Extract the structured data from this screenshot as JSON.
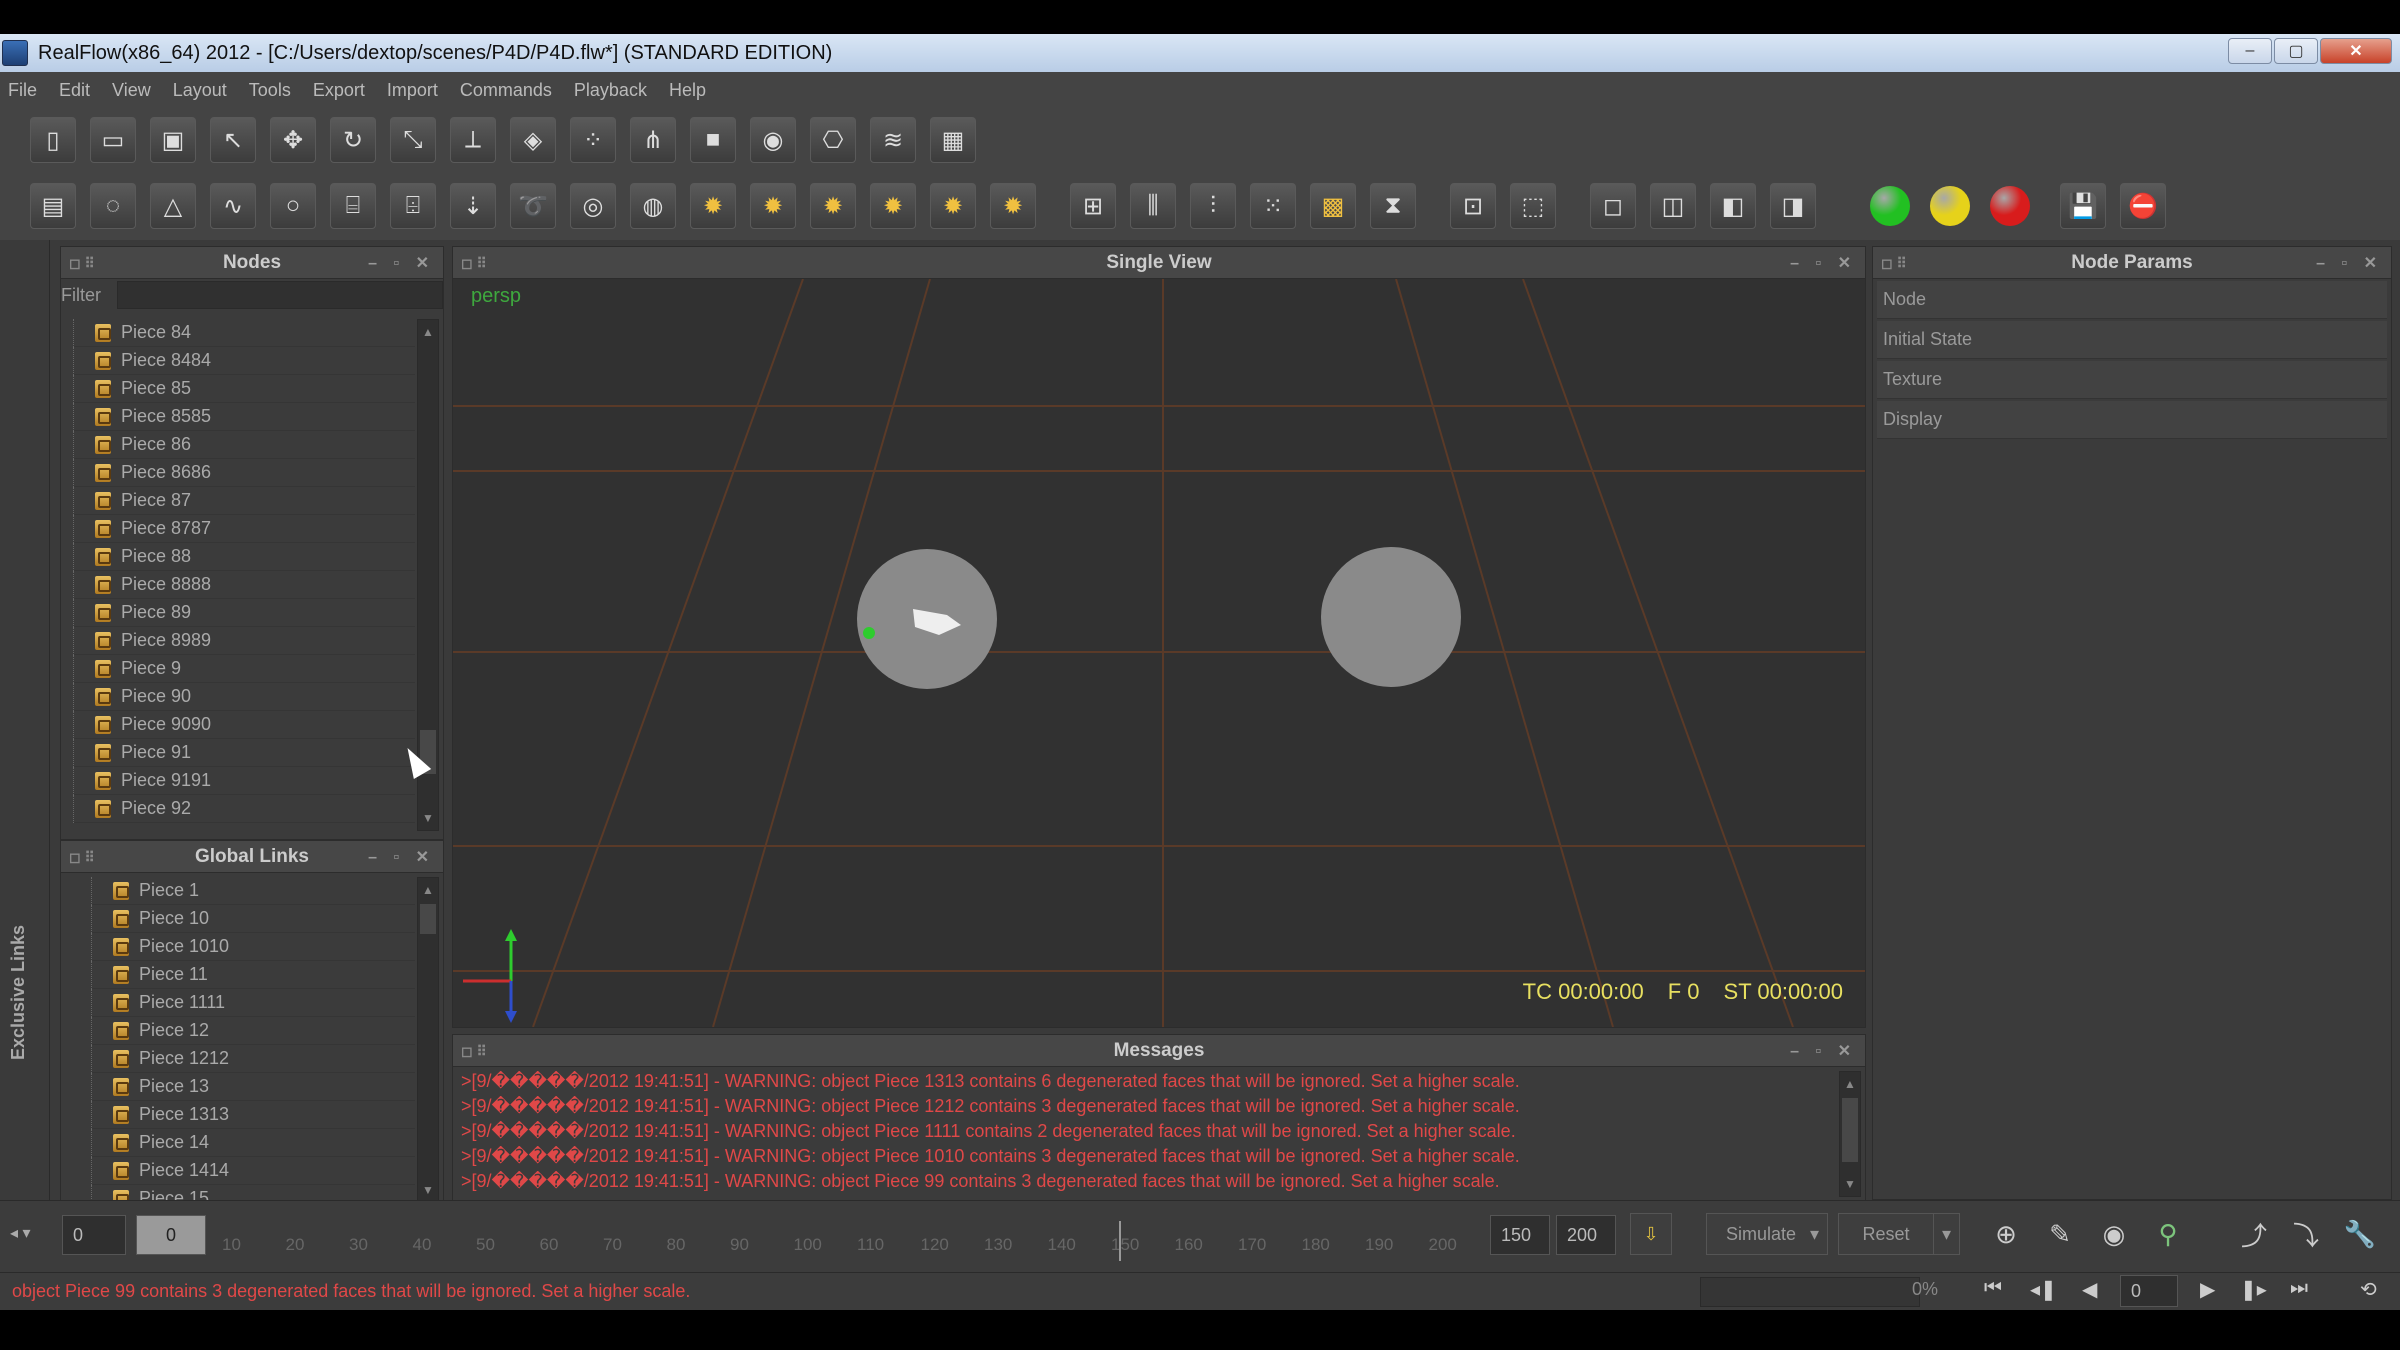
{
  "window": {
    "title": "RealFlow(x86_64) 2012 - [C:/Users/dextop/scenes/P4D/P4D.flw*] (STANDARD EDITION)",
    "btn_min": "–",
    "btn_max": "▢",
    "btn_close": "✕"
  },
  "menu": [
    "File",
    "Edit",
    "View",
    "Layout",
    "Tools",
    "Export",
    "Import",
    "Commands",
    "Playback",
    "Help"
  ],
  "toolbar1": [
    {
      "name": "new-scene-icon",
      "glyph": "▯"
    },
    {
      "name": "open-scene-icon",
      "glyph": "▭"
    },
    {
      "name": "save-scene-icon",
      "glyph": "▣"
    },
    {
      "name": "select-icon",
      "glyph": "↖"
    },
    {
      "name": "move-icon",
      "glyph": "✥"
    },
    {
      "name": "rotate-icon",
      "glyph": "↻"
    },
    {
      "name": "scale-icon",
      "glyph": "⤡"
    },
    {
      "name": "axis-icon",
      "glyph": "⟂"
    },
    {
      "name": "layers-icon",
      "glyph": "◈"
    },
    {
      "name": "particles-icon",
      "glyph": "⁘"
    },
    {
      "name": "constraint-icon",
      "glyph": "⋔"
    },
    {
      "name": "object-cube-icon",
      "glyph": "■"
    },
    {
      "name": "sphere-emitter-icon",
      "glyph": "◉"
    },
    {
      "name": "camera-icon",
      "glyph": "⎔"
    },
    {
      "name": "wave-icon",
      "glyph": "≋"
    },
    {
      "name": "mesh-icon",
      "glyph": "▦"
    }
  ],
  "toolbar2": [
    {
      "name": "emitter-square-icon",
      "glyph": "▤"
    },
    {
      "name": "emitter-circle-icon",
      "glyph": "◌"
    },
    {
      "name": "emitter-triangle-icon",
      "glyph": "△"
    },
    {
      "name": "emitter-spline-icon",
      "glyph": "∿"
    },
    {
      "name": "emitter-sphere-icon",
      "glyph": "○"
    },
    {
      "name": "emitter-cylinder-icon",
      "glyph": "⌸"
    },
    {
      "name": "emitter-fill-icon",
      "glyph": "⌹"
    },
    {
      "name": "daemon-gravity-icon",
      "glyph": "⇣"
    },
    {
      "name": "daemon-vortex-icon",
      "glyph": "➰"
    },
    {
      "name": "daemon-attractor-icon",
      "glyph": "◎"
    },
    {
      "name": "daemon-drag-icon",
      "glyph": "◍"
    },
    {
      "name": "light-1-icon",
      "glyph": "✹",
      "type": "sun"
    },
    {
      "name": "light-2-icon",
      "glyph": "✹",
      "type": "sun"
    },
    {
      "name": "light-3-icon",
      "glyph": "✹",
      "type": "sun"
    },
    {
      "name": "light-4-icon",
      "glyph": "✹",
      "type": "sun"
    },
    {
      "name": "light-5-icon",
      "glyph": "✹",
      "type": "sun"
    },
    {
      "name": "light-6-icon",
      "glyph": "✹",
      "type": "sun"
    },
    {
      "name": "mesher-icon",
      "glyph": "⊞",
      "gap": true
    },
    {
      "name": "wave-domain-icon",
      "glyph": "⫼"
    },
    {
      "name": "graph-icon",
      "glyph": "⫶"
    },
    {
      "name": "dots-icon",
      "glyph": "⁙"
    },
    {
      "name": "grid-mesh-icon",
      "glyph": "▩",
      "type": "cube"
    },
    {
      "name": "hourglass-icon",
      "glyph": "⧗"
    },
    {
      "name": "frame-icon",
      "glyph": "⊡",
      "gap": true
    },
    {
      "name": "dotted-frame-icon",
      "glyph": "⬚"
    },
    {
      "name": "view-front-icon",
      "glyph": "◻",
      "gap": true
    },
    {
      "name": "view-side-icon",
      "glyph": "◫"
    },
    {
      "name": "view-top-icon",
      "glyph": "◧"
    },
    {
      "name": "view-persp-icon",
      "glyph": "◨"
    }
  ],
  "status_lights": [
    {
      "name": "simulate-green-light",
      "color": "#22c022"
    },
    {
      "name": "simulate-yellow-light",
      "color": "#e6d21a"
    },
    {
      "name": "simulate-red-light",
      "color": "#d81c1c"
    }
  ],
  "save_icons": [
    {
      "name": "save-cache-icon",
      "glyph": "💾"
    },
    {
      "name": "reset-cache-icon",
      "glyph": "⛔"
    }
  ],
  "side_strip": {
    "label": "Exclusive Links"
  },
  "nodes_panel": {
    "title": "Nodes",
    "filter_label": "Filter",
    "filter_value": "",
    "items": [
      "Piece  84",
      "Piece  8484",
      "Piece  85",
      "Piece  8585",
      "Piece  86",
      "Piece  8686",
      "Piece  87",
      "Piece  8787",
      "Piece  88",
      "Piece  8888",
      "Piece  89",
      "Piece  8989",
      "Piece  9",
      "Piece  90",
      "Piece  9090",
      "Piece  91",
      "Piece  9191",
      "Piece  92"
    ]
  },
  "global_links_panel": {
    "title": "Global Links",
    "items": [
      "Piece  1",
      "Piece  10",
      "Piece  1010",
      "Piece  11",
      "Piece  1111",
      "Piece  12",
      "Piece  1212",
      "Piece  13",
      "Piece  1313",
      "Piece  14",
      "Piece  1414",
      "Piece  15"
    ]
  },
  "viewport": {
    "title": "Single View",
    "camera_label": "persp",
    "tc": "TC 00:00:00",
    "frame": "F 0",
    "st": "ST 00:00:00"
  },
  "messages_panel": {
    "title": "Messages",
    "lines": [
      ">[9/�����/2012 19:41:51] - WARNING: object Piece  1313 contains 6 degenerated faces that will be ignored. Set a higher scale.",
      ">[9/�����/2012 19:41:51] - WARNING: object Piece  1212 contains 3 degenerated faces that will be ignored. Set a higher scale.",
      ">[9/�����/2012 19:41:51] - WARNING: object Piece  1111 contains 2 degenerated faces that will be ignored. Set a higher scale.",
      ">[9/�����/2012 19:41:51] - WARNING: object Piece  1010 contains 3 degenerated faces that will be ignored. Set a higher scale.",
      ">[9/�����/2012 19:41:51] - WARNING: object Piece  99 contains 3 degenerated faces that will be ignored. Set a higher scale."
    ]
  },
  "node_params_panel": {
    "title": "Node Params",
    "sections": [
      "Node",
      "Initial State",
      "Texture",
      "Display"
    ]
  },
  "timeline": {
    "start": "0",
    "current": "0",
    "ticks": [
      "10",
      "20",
      "30",
      "40",
      "50",
      "60",
      "70",
      "80",
      "90",
      "100",
      "110",
      "120",
      "130",
      "140",
      "150",
      "160",
      "170",
      "180",
      "190",
      "200"
    ],
    "playhead_frame": 150,
    "range_end_a": "150",
    "range_end_b": "200",
    "simulate_label": "Simulate",
    "reset_label": "Reset"
  },
  "statusbar": {
    "message": "object Piece  99 contains 3 degenerated faces that will be ignored. Set a higher scale.",
    "progress": "0%",
    "frame_field": "0"
  }
}
